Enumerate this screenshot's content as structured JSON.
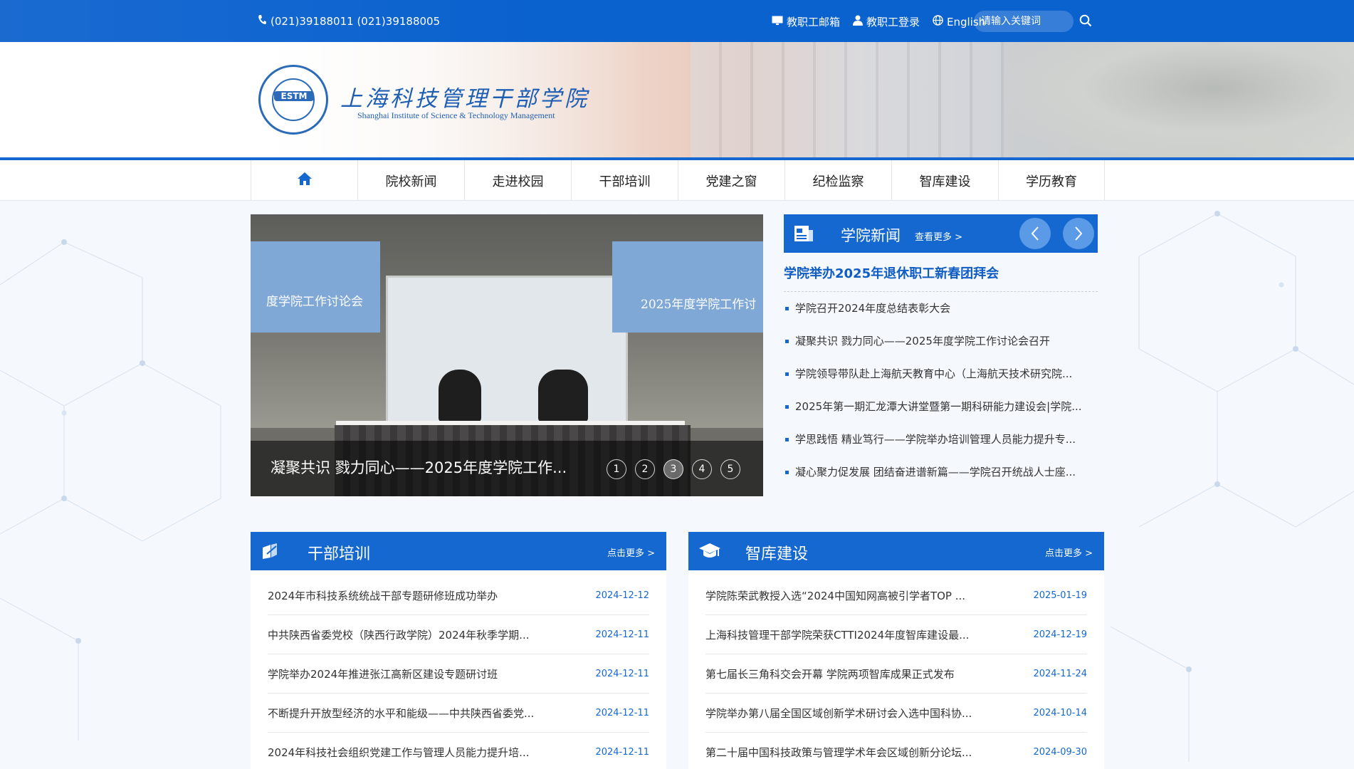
{
  "topbar": {
    "phone": "(021)39188011 (021)39188005",
    "links": {
      "mail": "教职工邮箱",
      "login": "教职工登录",
      "english": "English"
    },
    "search_placeholder": "请输入关键词"
  },
  "brand": {
    "badge": "ESTM",
    "name_cn": "上海科技管理干部学院",
    "name_en": "Shanghai Institute of Science & Technology Management"
  },
  "nav": {
    "items": [
      "院校新闻",
      "走进校园",
      "干部培训",
      "党建之窗",
      "纪检监察",
      "智库建设",
      "学历教育"
    ]
  },
  "slider": {
    "screen_left": "度学院工作讨论会",
    "screen_right": "2025年度学院工作讨",
    "caption": "凝聚共识 戮力同心——2025年度学院工作...",
    "dots": [
      "1",
      "2",
      "3",
      "4",
      "5"
    ],
    "active_dot": 3
  },
  "college_news": {
    "title": "学院新闻",
    "more": "查看更多 >",
    "featured": "学院举办2025年退休职工新春团拜会",
    "items": [
      "学院召开2024年度总结表彰大会",
      "凝聚共识 戮力同心——2025年度学院工作讨论会召开",
      "学院领导带队赴上海航天教育中心（上海航天技术研究院...",
      "2025年第一期汇龙潭大讲堂暨第一期科研能力建设会|学院...",
      "学思践悟 精业笃行——学院举办培训管理人员能力提升专...",
      "凝心聚力促发展 团结奋进谱新篇——学院召开统战人士座..."
    ]
  },
  "cadre_training": {
    "title": "干部培训",
    "more": "点击更多 >",
    "items": [
      {
        "title": "2024年市科技系统统战干部专题研修班成功举办",
        "date": "2024-12-12"
      },
      {
        "title": "中共陕西省委党校（陕西行政学院）2024年秋季学期...",
        "date": "2024-12-11"
      },
      {
        "title": "学院举办2024年推进张江高新区建设专题研讨班",
        "date": "2024-12-11"
      },
      {
        "title": "不断提升开放型经济的水平和能级——中共陕西省委党...",
        "date": "2024-12-11"
      },
      {
        "title": "2024年科技社会组织党建工作与管理人员能力提升培...",
        "date": "2024-12-11"
      }
    ]
  },
  "think_tank": {
    "title": "智库建设",
    "more": "点击更多 >",
    "items": [
      {
        "title": "学院陈荣武教授入选“2024中国知网高被引学者TOP ...",
        "date": "2025-01-19"
      },
      {
        "title": "上海科技管理干部学院荣获CTTI2024年度智库建设最...",
        "date": "2024-12-19"
      },
      {
        "title": "第七届长三角科交会开幕 学院两项智库成果正式发布",
        "date": "2024-11-24"
      },
      {
        "title": "学院举办第八届全国区域创新学术研讨会入选中国科协...",
        "date": "2024-10-14"
      },
      {
        "title": "第二十届中国科技政策与管理学术年会区域创新分论坛...",
        "date": "2024-09-30"
      }
    ]
  },
  "colors": {
    "primary": "#1468d0",
    "accent_link": "#0f5cc2"
  }
}
